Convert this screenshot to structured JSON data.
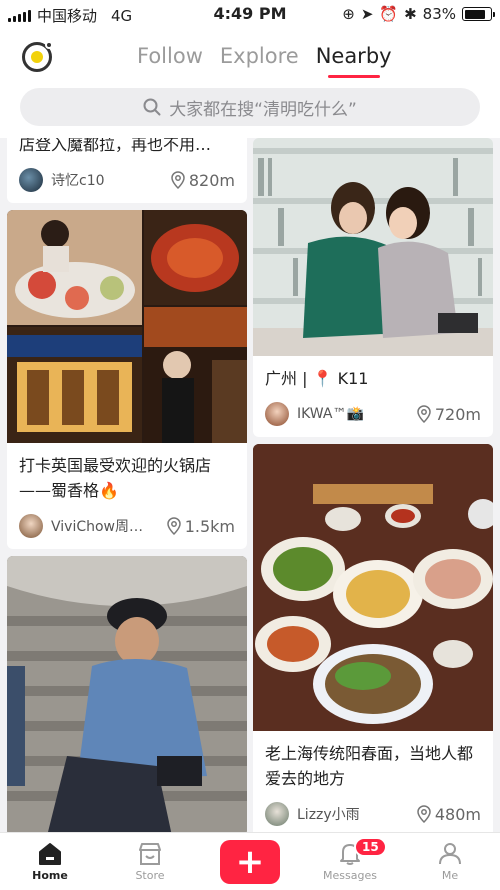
{
  "status_bar": {
    "carrier": "中国移动",
    "network": "4G",
    "time": "4:49 PM",
    "battery": "83%",
    "battery_level": 0.83
  },
  "header": {
    "tabs": [
      {
        "label": "Follow",
        "active": false
      },
      {
        "label": "Explore",
        "active": false
      },
      {
        "label": "Nearby",
        "active": true
      }
    ],
    "search_placeholder": "大家都在搜“清明吃什么”"
  },
  "feed": {
    "left": [
      {
        "title": "店登入魔都拉，再也不用…",
        "user": "诗忆c10",
        "distance": "820m",
        "image": ""
      },
      {
        "title": "打卡英国最受欢迎的火锅店——蜀香格🔥",
        "user": "ViviChow周…",
        "distance": "1.5km",
        "image": "hotpot-restaurant-collage"
      },
      {
        "title": "",
        "user": "",
        "distance": "",
        "image": "man-sitting-on-stone-steps"
      }
    ],
    "right": [
      {
        "title": "广州 | 📍 K11",
        "user": "IKWA™📸",
        "distance": "720m",
        "image": "two-women-sitting-on-floor"
      },
      {
        "title": "老上海传统阳春面，当地人都爱去的地方",
        "user": "Lizzy小雨",
        "distance": "480m",
        "image": "noodle-meal-set-on-table"
      }
    ]
  },
  "bottom_nav": {
    "items": [
      "Home",
      "Store",
      "Messages",
      "Me"
    ],
    "messages_badge": "15"
  },
  "colors": {
    "accent": "#ff2442",
    "tab_inactive": "#9b9b9b"
  }
}
